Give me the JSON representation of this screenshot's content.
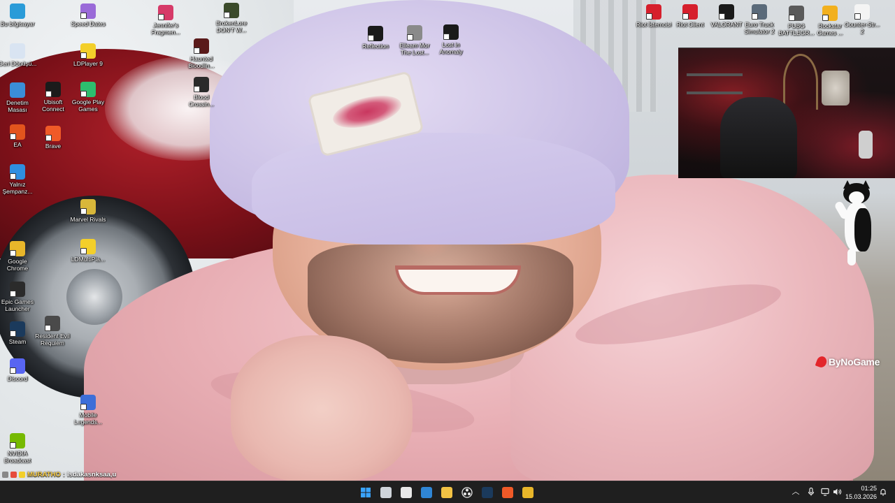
{
  "desktop": {
    "icons": [
      {
        "id": "bu-bilgisayar",
        "label": "Bu bilgisayar",
        "color": "#2a9bd8"
      },
      {
        "id": "geri-donusum",
        "label": "Geri Dönüşü...",
        "color": "#d9e4f2"
      },
      {
        "id": "denetim-masasi",
        "label": "Denetim Masası",
        "color": "#3b8ed8"
      },
      {
        "id": "ea",
        "label": "EA",
        "color": "#e2541d"
      },
      {
        "id": "yalniz-sempanze",
        "label": "Yalnız Şempanz...",
        "color": "#2f8ee0"
      },
      {
        "id": "google-chrome",
        "label": "Google Chrome",
        "color": "#e8b62a"
      },
      {
        "id": "epic-games",
        "label": "Epic Games Launcher",
        "color": "#2b2b2b"
      },
      {
        "id": "steam",
        "label": "Steam",
        "color": "#1b3a5c"
      },
      {
        "id": "discord",
        "label": "Discord",
        "color": "#5865f2"
      },
      {
        "id": "nvidia-broadcast",
        "label": "NVIDIA Broadcast",
        "color": "#76b900"
      },
      {
        "id": "speed-dates",
        "label": "Speed Dates",
        "color": "#9a6ad8"
      },
      {
        "id": "ldplayer9",
        "label": "LDPlayer 9",
        "color": "#f3cf2a"
      },
      {
        "id": "ubisoft-connect",
        "label": "Ubisoft Connect",
        "color": "#1b1b1b"
      },
      {
        "id": "brave",
        "label": "Brave",
        "color": "#f05a28"
      },
      {
        "id": "google-play-games",
        "label": "Google Play Games",
        "color": "#2dbd6e"
      },
      {
        "id": "marvel-rivals",
        "label": "Marvel Rivals",
        "color": "#d8b73a"
      },
      {
        "id": "ldmultiplayer",
        "label": "LDMultiPla...",
        "color": "#f3cf2a"
      },
      {
        "id": "resident-evil",
        "label": "Resident Evil Requiem",
        "color": "#4a4a4a"
      },
      {
        "id": "mobile-legends",
        "label": "Mobile Legends...",
        "color": "#3c6ed8"
      },
      {
        "id": "jennifers-fragment",
        "label": "Jennifer's Fragmen...",
        "color": "#d63a68"
      },
      {
        "id": "haunted-bloodline",
        "label": "Haunted Bloodlin...",
        "color": "#5a1a1a"
      },
      {
        "id": "blood-crossing",
        "label": "Blood Crossin...",
        "color": "#2a2a2a"
      },
      {
        "id": "brokenlore",
        "label": "BrokenLore DON'T W...",
        "color": "#3a4a2a"
      },
      {
        "id": "reflection",
        "label": "Reflection",
        "color": "#1a1a1a"
      },
      {
        "id": "elleam-mor",
        "label": "Elleam Mor The Lost...",
        "color": "#8a8a8a"
      },
      {
        "id": "lost-in-anomaly",
        "label": "Lost in Anomaly",
        "color": "#1a1a1a"
      },
      {
        "id": "riot-istemcisi",
        "label": "Riot İstemcisi",
        "color": "#d61f2c"
      },
      {
        "id": "riot-client",
        "label": "Riot Client",
        "color": "#d61f2c"
      },
      {
        "id": "valorant",
        "label": "VALORANT",
        "color": "#1a1a1a"
      },
      {
        "id": "euro-truck",
        "label": "Euro Truck Simulator 2",
        "color": "#5a6a7a"
      },
      {
        "id": "pubg",
        "label": "PUBG BATTLEGR...",
        "color": "#5a5a5a"
      },
      {
        "id": "rockstar",
        "label": "Rockstar Games ...",
        "color": "#f2b01e"
      },
      {
        "id": "counter-strike",
        "label": "Counter-Str... 2",
        "color": "#f4f4f4"
      }
    ]
  },
  "overlays": {
    "watermark": "ByNoGame",
    "chat": {
      "user": "MURATHO",
      "separator": ":",
      "message": "lsdakasnksaa,u"
    }
  },
  "taskbar": {
    "apps": [
      {
        "id": "start",
        "icon": "windows-start-icon",
        "color": "#3aa4ff"
      },
      {
        "id": "task-view",
        "icon": "task-view-icon",
        "color": "#cfd4da"
      },
      {
        "id": "snipping",
        "icon": "snipping-tool-icon",
        "color": "#e8e8e8"
      },
      {
        "id": "photos",
        "icon": "photos-icon",
        "color": "#2f86d6"
      },
      {
        "id": "explorer",
        "icon": "file-explorer-icon",
        "color": "#f2c244"
      },
      {
        "id": "obs",
        "icon": "obs-icon",
        "color": "#3a3a3a"
      },
      {
        "id": "steam",
        "icon": "steam-icon",
        "color": "#1b3a5c"
      },
      {
        "id": "brave",
        "icon": "brave-icon",
        "color": "#f05a28"
      },
      {
        "id": "app",
        "icon": "app-icon",
        "color": "#e8b62a"
      }
    ],
    "clock": {
      "time": "01:25",
      "date": "15.03.2026"
    }
  }
}
